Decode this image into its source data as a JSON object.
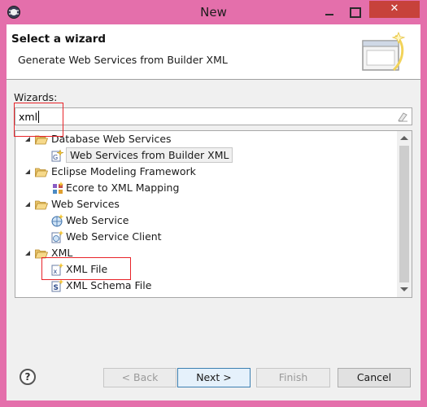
{
  "window": {
    "title": "New",
    "close_glyph": "✕"
  },
  "header": {
    "title": "Select a wizard",
    "description": "Generate Web Services from Builder XML",
    "graphic_icon": "wizard-banner-icon"
  },
  "wizards_label": "Wizards:",
  "filter": {
    "value": "xml",
    "clear_icon": "clear-filter-icon"
  },
  "tree": [
    {
      "label": "Database Web Services",
      "kind": "folder",
      "expanded": true
    },
    {
      "label": "Web Services from Builder XML",
      "kind": "item",
      "icon": "web-services-wizard-icon",
      "selected": true
    },
    {
      "label": "Eclipse Modeling Framework",
      "kind": "folder",
      "expanded": true
    },
    {
      "label": "Ecore to XML Mapping",
      "kind": "item",
      "icon": "ecore-mapping-icon"
    },
    {
      "label": "Web Services",
      "kind": "folder",
      "expanded": true
    },
    {
      "label": "Web Service",
      "kind": "item",
      "icon": "web-service-icon"
    },
    {
      "label": "Web Service Client",
      "kind": "item",
      "icon": "web-service-client-icon"
    },
    {
      "label": "XML",
      "kind": "folder",
      "expanded": true
    },
    {
      "label": "XML File",
      "kind": "item",
      "icon": "xml-file-icon"
    },
    {
      "label": "XML Schema File",
      "kind": "item",
      "icon": "xml-schema-file-icon"
    }
  ],
  "help": {
    "glyph": "?"
  },
  "buttons": {
    "back": "< Back",
    "next": "Next >",
    "finish": "Finish",
    "cancel": "Cancel"
  },
  "colors": {
    "window_frame": "#e46fab",
    "close_button": "#c7423b",
    "highlight_box": "#e8242a"
  }
}
